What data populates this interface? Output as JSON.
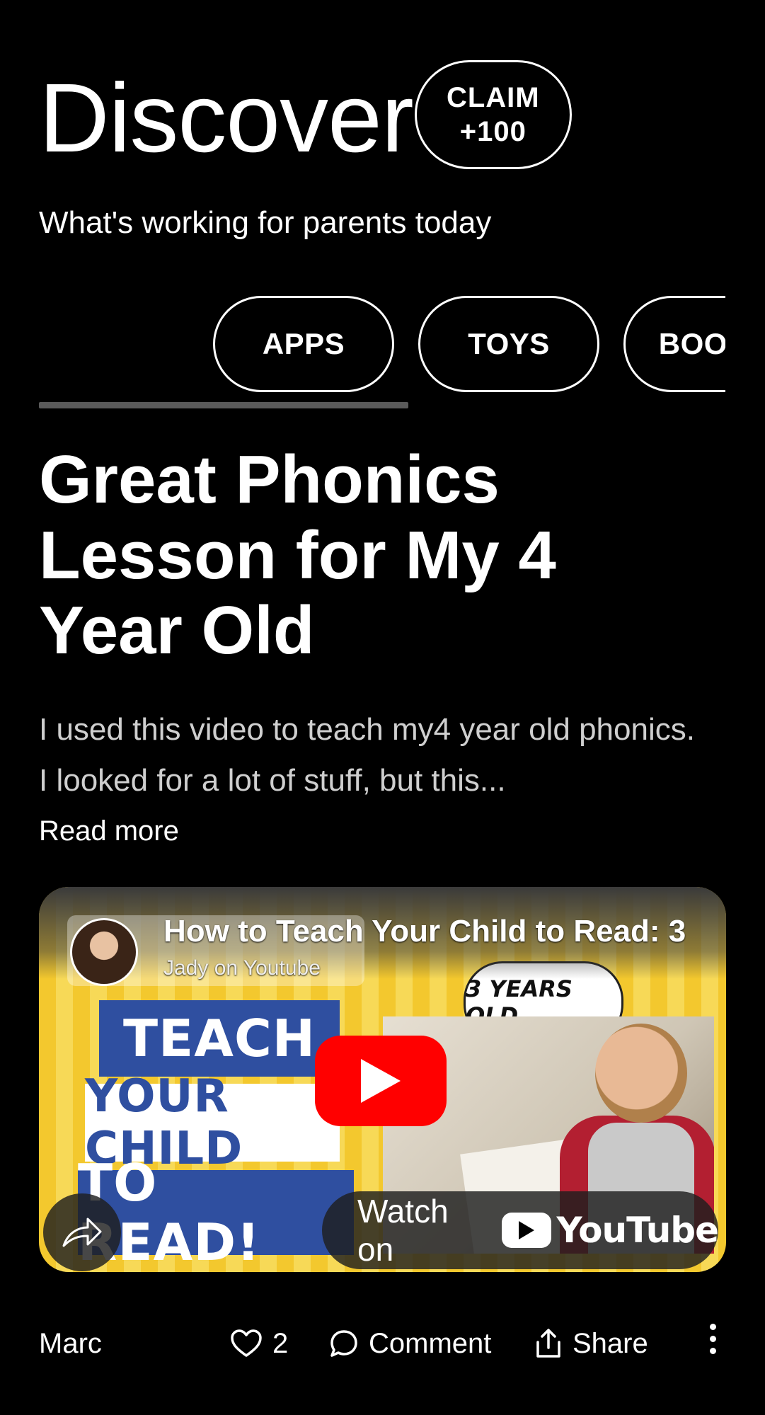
{
  "header": {
    "title": "Discover",
    "claim_line1": "CLAIM",
    "claim_line2": "+100",
    "subtitle": "What's working for parents today"
  },
  "tabs": [
    {
      "label": "APPS"
    },
    {
      "label": "TOYS"
    },
    {
      "label": "BOOKS"
    }
  ],
  "post": {
    "title": "Great Phonics Lesson for My 4 Year Old",
    "body": "I used this video to teach my4 year old phonics. I looked for a lot of stuff, but this...",
    "read_more": "Read more"
  },
  "video": {
    "title": "How to Teach Your Child to Read: 3",
    "channel": "Jady on Youtube",
    "thumb_line1": "TEACH",
    "thumb_line2": "YOUR CHILD",
    "thumb_line3": "TO READ!",
    "thumb_badge": "3 YEARS OLD",
    "watch_on": "Watch on",
    "yt_logo_text": "YouTube"
  },
  "footer": {
    "author": "Marc",
    "likes": "2",
    "comment_label": "Comment",
    "share_label": "Share"
  },
  "colors": {
    "background": "#000000",
    "text": "#ffffff",
    "youtube_red": "#ff0000",
    "tab_underline": "#5a5a5a"
  }
}
